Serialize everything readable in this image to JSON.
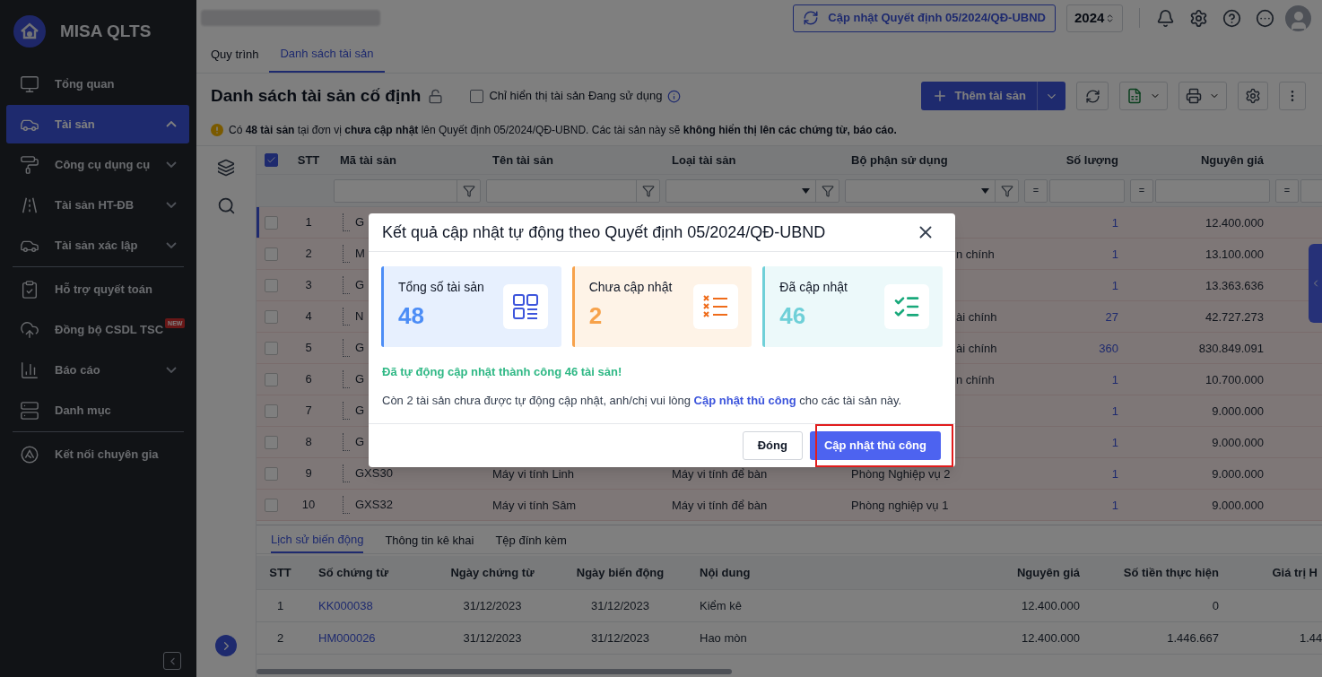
{
  "app": {
    "name": "MISA QLTS"
  },
  "sidebar": {
    "groups": [
      [
        {
          "label": "Tổng quan",
          "selected": false
        },
        {
          "label": "Tài sản",
          "selected": true,
          "expanded": true
        },
        {
          "label": "Công cụ dụng cụ",
          "selected": false,
          "expanded": false
        },
        {
          "label": "Tài sản HT-ĐB",
          "selected": false,
          "expanded": false
        },
        {
          "label": "Tài sản xác lập",
          "selected": false,
          "expanded": false
        }
      ],
      [
        {
          "label": "Hỗ trợ quyết toán",
          "selected": false
        },
        {
          "label": "Đồng bộ CSDL TSC",
          "selected": false,
          "badge": "NEW"
        },
        {
          "label": "Báo cáo",
          "selected": false,
          "expanded": false
        },
        {
          "label": "Danh mục",
          "selected": false
        }
      ],
      [
        {
          "label": "Kết nối chuyên gia",
          "selected": false
        }
      ]
    ]
  },
  "topbar": {
    "update_button": "Cập nhật Quyết định 05/2024/QĐ-UBND",
    "year": "2024"
  },
  "tabs": [
    {
      "label": "Quy trình",
      "selected": false
    },
    {
      "label": "Danh sách tài sản",
      "selected": true
    }
  ],
  "page_title": "Danh sách tài sản cố định",
  "filter_checkbox": {
    "label": "Chỉ hiển thị tài sản Đang sử dụng",
    "checked": false
  },
  "add_button": "Thêm tài sản",
  "warning": "Có **48 tài sản** tại đơn vị **chưa cập nhật** lên Quyết định 05/2024/QĐ-UBND. Các tài sản này sẽ **không hiển thị lên các chứng từ, báo cáo.**",
  "table": {
    "all_checked": true,
    "columns": [
      "STT",
      "Mã tài sản",
      "Tên tài sản",
      "Loại tài sản",
      "Bộ phận sử dụng",
      "Số lượng",
      "Nguyên giá"
    ],
    "filter_ops": [
      "=",
      "=",
      "="
    ],
    "rows": [
      {
        "stt": "1",
        "code": "G",
        "quantity": "1",
        "cost": "12.400.000",
        "checked": false,
        "selected": true
      },
      {
        "stt": "2",
        "code": "M",
        "department": "n chính",
        "quantity": "1",
        "cost": "13.100.000",
        "checked": false,
        "selected": false
      },
      {
        "stt": "3",
        "code": "G",
        "quantity": "1",
        "cost": "13.363.636",
        "checked": false,
        "selected": false
      },
      {
        "stt": "4",
        "code": "N",
        "department": "ài chính",
        "quantity": "27",
        "cost": "42.727.273",
        "checked": false,
        "selected": false
      },
      {
        "stt": "5",
        "code": "G",
        "department": "ài chính",
        "quantity": "360",
        "cost": "830.849.091",
        "checked": false,
        "selected": false
      },
      {
        "stt": "6",
        "code": "G",
        "department": "n chính",
        "quantity": "1",
        "cost": "10.700.000",
        "checked": false,
        "selected": false
      },
      {
        "stt": "7",
        "code": "G",
        "quantity": "1",
        "cost": "9.000.000",
        "checked": false,
        "selected": false
      },
      {
        "stt": "8",
        "code": "G",
        "quantity": "1",
        "cost": "9.000.000",
        "checked": false,
        "selected": false
      },
      {
        "stt": "9",
        "code": "GXS30",
        "name": "Máy vi tính Linh",
        "type": "Máy vi tính để bàn",
        "department": "Phòng Nghiệp vụ 2",
        "quantity": "1",
        "cost": "9.000.000",
        "checked": false,
        "selected": false
      },
      {
        "stt": "10",
        "code": "GXS32",
        "name": "Máy vi tính Sâm",
        "type": "Máy vi tính để bàn",
        "department": "Phòng nghiệp vụ 1",
        "quantity": "1",
        "cost": "9.000.000",
        "checked": false,
        "selected": false
      }
    ]
  },
  "detail": {
    "tabs": [
      {
        "label": "Lịch sử biến động",
        "selected": true
      },
      {
        "label": "Thông tin kê khai",
        "selected": false
      },
      {
        "label": "Tệp đính kèm",
        "selected": false
      }
    ],
    "columns": [
      "STT",
      "Số chứng từ",
      "Ngày chứng từ",
      "Ngày biến động",
      "Nội dung",
      "Nguyên giá",
      "Số tiền thực hiện",
      "Giá trị H"
    ],
    "rows": [
      [
        "1",
        "KK000038",
        "31/12/2023",
        "31/12/2023",
        "Kiểm kê",
        "12.400.000",
        "0",
        ""
      ],
      [
        "2",
        "HM000026",
        "31/12/2023",
        "31/12/2023",
        "Hao mòn",
        "12.400.000",
        "1.446.667",
        "1.44"
      ]
    ]
  },
  "dialog": {
    "title": "Kết quả cập nhật tự động theo Quyết định 05/2024/QĐ-UBND",
    "cards": [
      {
        "label": "Tổng số tài sản",
        "value": "48",
        "color": "#4c8df6"
      },
      {
        "label": "Chưa cập nhật",
        "value": "2",
        "color": "#f7a24b"
      },
      {
        "label": "Đã cập nhật",
        "value": "46",
        "color": "#6fd0d8"
      }
    ],
    "success": "Đã tự động cập nhật thành công 46 tài sản!",
    "note": {
      "before": "Còn 2 tài sản chưa được tự động cập nhật, anh/chị vui lòng ",
      "link": "Cập nhật thủ công",
      "after": " cho các tài sản này."
    },
    "close_button": "Đóng",
    "primary_button": "Cập nhật thủ công",
    "primary_highlighted": true
  }
}
